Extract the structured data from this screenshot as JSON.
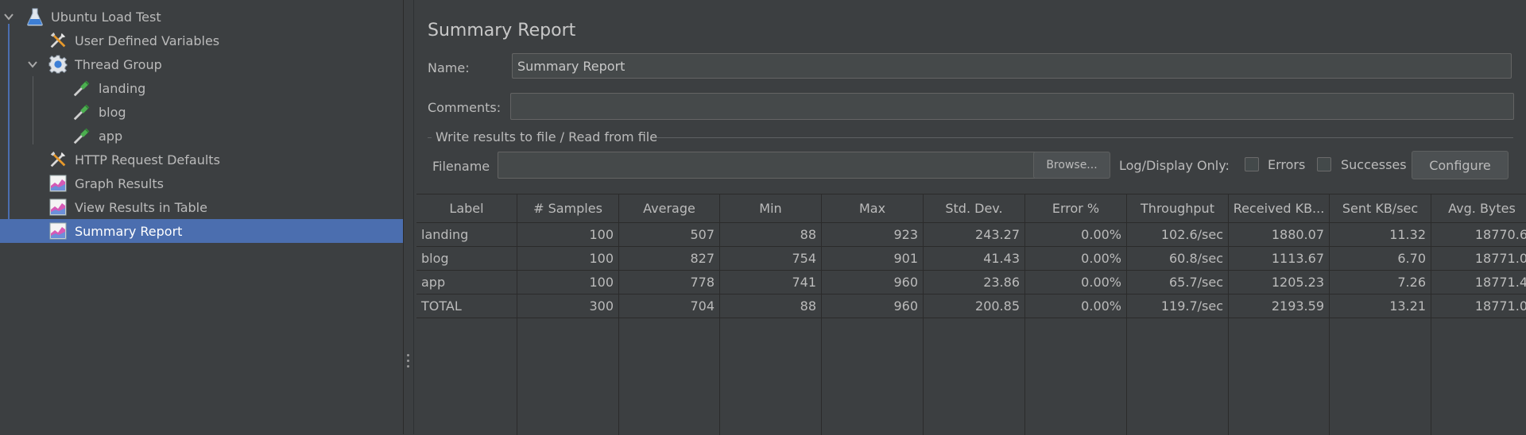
{
  "tree": {
    "items": [
      {
        "label": "Ubuntu Load Test",
        "icon": "flask-icon"
      },
      {
        "label": "User Defined Variables",
        "icon": "wrench-screwdriver-icon"
      },
      {
        "label": "Thread Group",
        "icon": "gear-icon"
      },
      {
        "label": "landing",
        "icon": "pipette-icon"
      },
      {
        "label": "blog",
        "icon": "pipette-icon"
      },
      {
        "label": "app",
        "icon": "pipette-icon"
      },
      {
        "label": "HTTP Request Defaults",
        "icon": "wrench-screwdriver-icon"
      },
      {
        "label": "Graph Results",
        "icon": "chart-icon"
      },
      {
        "label": "View Results in Table",
        "icon": "chart-icon"
      },
      {
        "label": "Summary Report",
        "icon": "chart-icon",
        "selected": true
      }
    ]
  },
  "panel": {
    "title": "Summary Report",
    "name_label": "Name:",
    "name_value": "Summary Report",
    "comments_label": "Comments:",
    "comments_value": "",
    "group_title": "Write results to file / Read from file",
    "filename_label": "Filename",
    "filename_value": "",
    "browse_label": "Browse...",
    "log_display_label": "Log/Display Only:",
    "errors_label": "Errors",
    "errors_checked": false,
    "successes_label": "Successes",
    "successes_checked": false,
    "configure_label": "Configure"
  },
  "table": {
    "headers": [
      "Label",
      "# Samples",
      "Average",
      "Min",
      "Max",
      "Std. Dev.",
      "Error %",
      "Throughput",
      "Received KB...",
      "Sent KB/sec",
      "Avg. Bytes"
    ],
    "rows": [
      [
        "landing",
        "100",
        "507",
        "88",
        "923",
        "243.27",
        "0.00%",
        "102.6/sec",
        "1880.07",
        "11.32",
        "18770.6"
      ],
      [
        "blog",
        "100",
        "827",
        "754",
        "901",
        "41.43",
        "0.00%",
        "60.8/sec",
        "1113.67",
        "6.70",
        "18771.0"
      ],
      [
        "app",
        "100",
        "778",
        "741",
        "960",
        "23.86",
        "0.00%",
        "65.7/sec",
        "1205.23",
        "7.26",
        "18771.4"
      ],
      [
        "TOTAL",
        "300",
        "704",
        "88",
        "960",
        "200.85",
        "0.00%",
        "119.7/sec",
        "2193.59",
        "13.21",
        "18771.0"
      ]
    ]
  },
  "colors": {
    "background": "#3c3f41",
    "selection": "#4b6eaf",
    "text": "#bbbbbb"
  }
}
